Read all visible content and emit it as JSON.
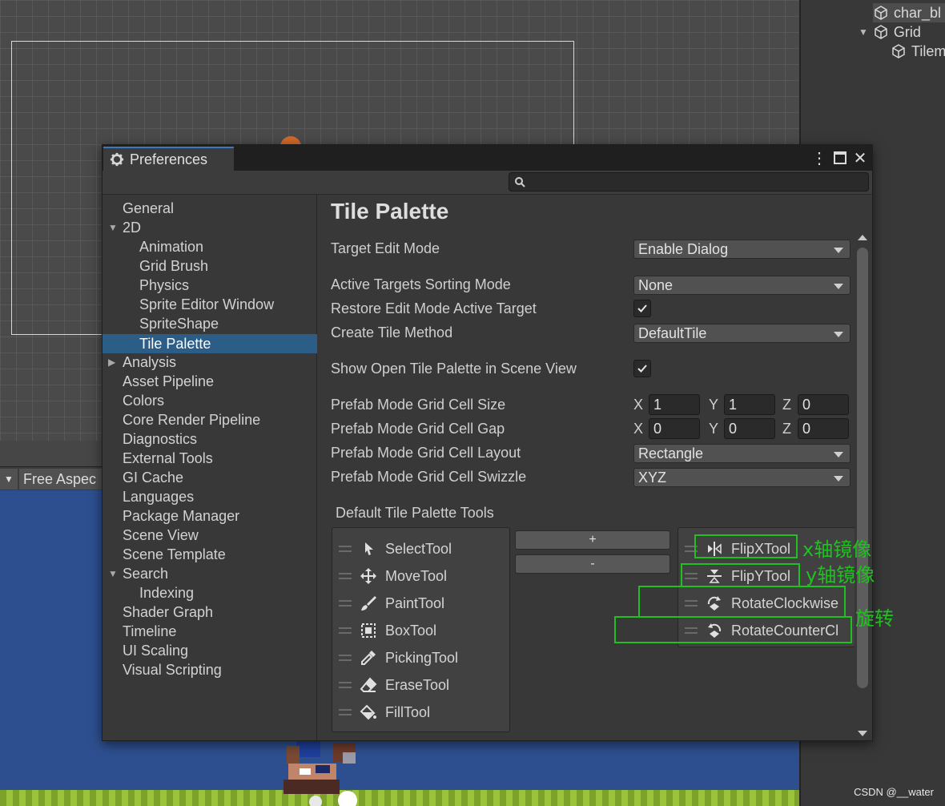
{
  "hierarchy": {
    "items": [
      {
        "label": "char_bl",
        "expanded": null
      },
      {
        "label": "Grid",
        "expanded": true
      },
      {
        "label": "Tilem",
        "expanded": null
      }
    ]
  },
  "game_view": {
    "aspect_label": "Free Aspec",
    "dropdown_glyph": "▼"
  },
  "watermark": "CSDN @__water",
  "preferences": {
    "tab_label": "Preferences",
    "titlebar_glyphs": {
      "menu": "⋮",
      "maximize": "□",
      "close": "✕"
    },
    "search": {
      "placeholder": "",
      "value": ""
    },
    "nav": [
      {
        "label": "General",
        "level": 0
      },
      {
        "label": "2D",
        "level": 0,
        "expander": "▼"
      },
      {
        "label": "Animation",
        "level": 1
      },
      {
        "label": "Grid Brush",
        "level": 1
      },
      {
        "label": "Physics",
        "level": 1
      },
      {
        "label": "Sprite Editor Window",
        "level": 1
      },
      {
        "label": "SpriteShape",
        "level": 1
      },
      {
        "label": "Tile Palette",
        "level": 1,
        "active": true
      },
      {
        "label": "Analysis",
        "level": 0,
        "expander": "▶"
      },
      {
        "label": "Asset Pipeline",
        "level": 0
      },
      {
        "label": "Colors",
        "level": 0
      },
      {
        "label": "Core Render Pipeline",
        "level": 0
      },
      {
        "label": "Diagnostics",
        "level": 0
      },
      {
        "label": "External Tools",
        "level": 0
      },
      {
        "label": "GI Cache",
        "level": 0
      },
      {
        "label": "Languages",
        "level": 0
      },
      {
        "label": "Package Manager",
        "level": 0
      },
      {
        "label": "Scene View",
        "level": 0
      },
      {
        "label": "Scene Template",
        "level": 0
      },
      {
        "label": "Search",
        "level": 0,
        "expander": "▼"
      },
      {
        "label": "Indexing",
        "level": 1
      },
      {
        "label": "Shader Graph",
        "level": 0
      },
      {
        "label": "Timeline",
        "level": 0
      },
      {
        "label": "UI Scaling",
        "level": 0
      },
      {
        "label": "Visual Scripting",
        "level": 0
      }
    ],
    "page": {
      "title": "Tile Palette",
      "target_edit_mode": {
        "label": "Target Edit Mode",
        "value": "Enable Dialog"
      },
      "active_targets_sorting_mode": {
        "label": "Active Targets Sorting Mode",
        "value": "None"
      },
      "restore_edit_mode": {
        "label": "Restore Edit Mode Active Target",
        "checked": true
      },
      "create_tile_method": {
        "label": "Create Tile Method",
        "value": "DefaultTile"
      },
      "show_open_tile_palette": {
        "label": "Show Open Tile Palette in Scene View",
        "checked": true
      },
      "cell_size": {
        "label": "Prefab Mode Grid Cell Size",
        "x": "1",
        "y": "1",
        "z": "0"
      },
      "cell_gap": {
        "label": "Prefab Mode Grid Cell Gap",
        "x": "0",
        "y": "0",
        "z": "0"
      },
      "cell_layout": {
        "label": "Prefab Mode Grid Cell Layout",
        "value": "Rectangle"
      },
      "cell_swizzle": {
        "label": "Prefab Mode Grid Cell Swizzle",
        "value": "XYZ"
      },
      "axis_labels": {
        "x": "X",
        "y": "Y",
        "z": "Z"
      },
      "tools_section_label": "Default Tile Palette Tools",
      "available_tools": [
        {
          "label": "SelectTool",
          "icon": "select-arrow-icon"
        },
        {
          "label": "MoveTool",
          "icon": "move-arrows-icon"
        },
        {
          "label": "PaintTool",
          "icon": "paint-brush-icon"
        },
        {
          "label": "BoxTool",
          "icon": "box-select-icon"
        },
        {
          "label": "PickingTool",
          "icon": "eyedropper-icon"
        },
        {
          "label": "EraseTool",
          "icon": "eraser-icon"
        },
        {
          "label": "FillTool",
          "icon": "paint-bucket-icon"
        }
      ],
      "add_button": "+",
      "remove_button": "-",
      "selected_tools": [
        {
          "label": "FlipXTool",
          "icon": "flip-x-icon"
        },
        {
          "label": "FlipYTool",
          "icon": "flip-y-icon"
        },
        {
          "label": "RotateClockwise",
          "icon": "rotate-clockwise-icon"
        },
        {
          "label": "RotateCounterCl",
          "icon": "rotate-counter-clockwise-icon"
        }
      ]
    }
  },
  "annotations": {
    "flip_x": "x轴镜像",
    "flip_y": "y轴镜像",
    "rotate": "旋转",
    "color": "#20c020"
  },
  "colors": {
    "selection_blue": "#2c5d87",
    "tab_accent": "#3a79bb",
    "annotation_green": "#20c020"
  }
}
